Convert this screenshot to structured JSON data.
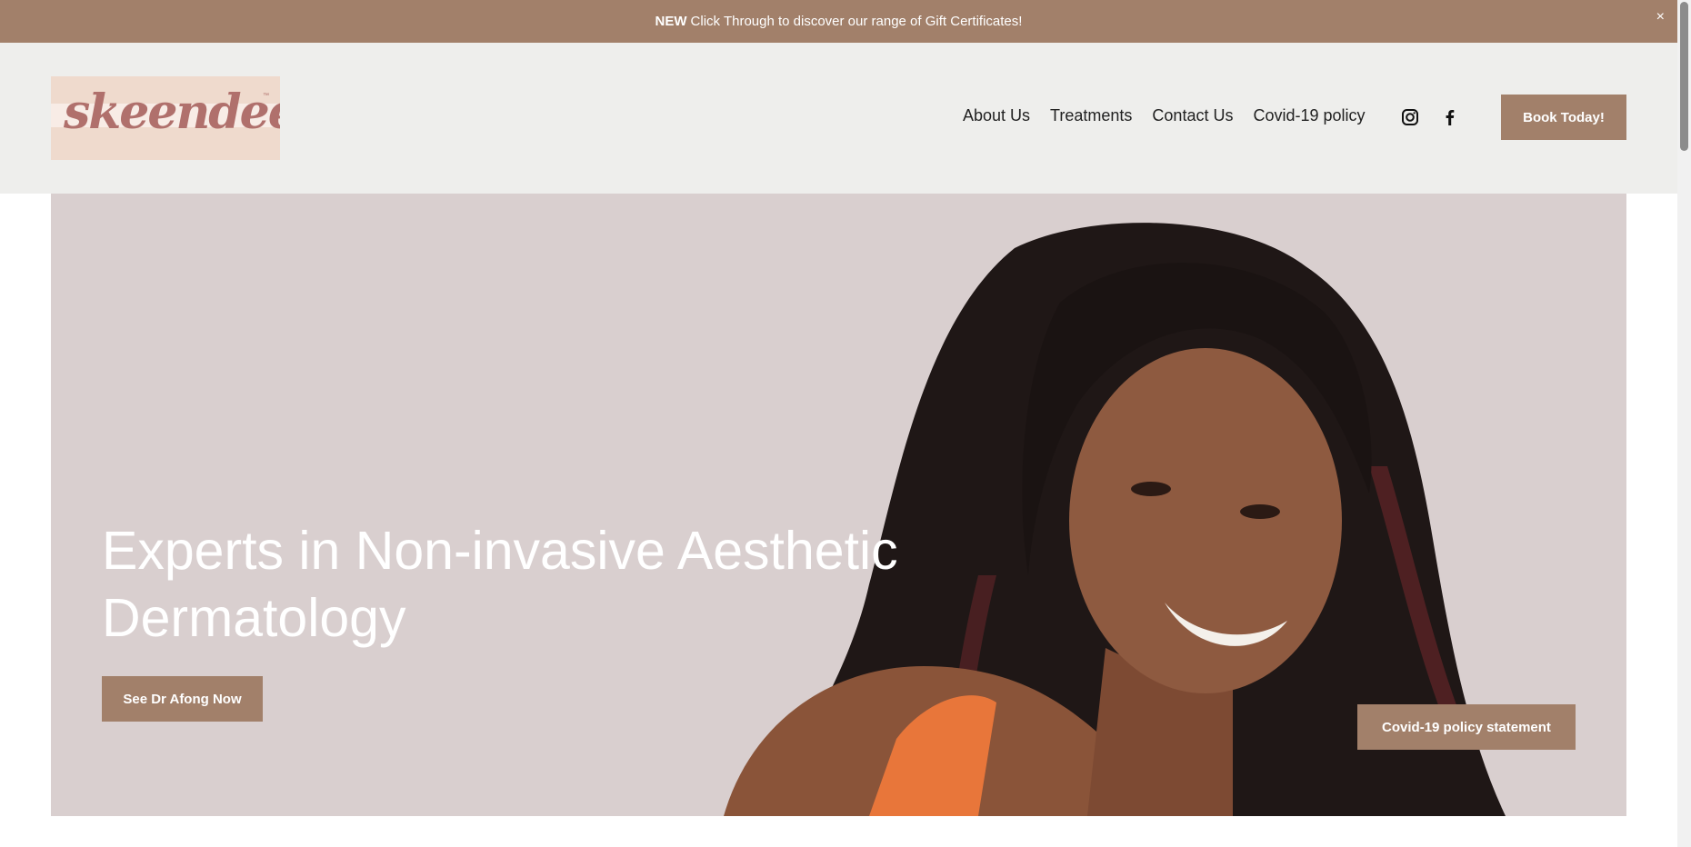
{
  "announcement": {
    "badge": "NEW",
    "text": "Click Through to discover our range of Gift Certificates!",
    "close_label": "×"
  },
  "header": {
    "logo_text": "skeendeep",
    "logo_tm": "™",
    "nav": [
      "About Us",
      "Treatments",
      "Contact Us",
      "Covid-19 policy"
    ],
    "social_icons": [
      "instagram-icon",
      "facebook-icon"
    ],
    "book_label": "Book Today!"
  },
  "hero": {
    "headline": "Experts in Non-invasive Aesthetic Dermatology",
    "cta_label": "See Dr Afong Now",
    "covid_label": "Covid-19 policy statement"
  },
  "colors": {
    "accent": "#a2806a",
    "header_bg": "#eeeeec",
    "hero_bg": "#d9cfcf",
    "logo_bg": "#efdacd",
    "logo_text": "#b0706c"
  }
}
